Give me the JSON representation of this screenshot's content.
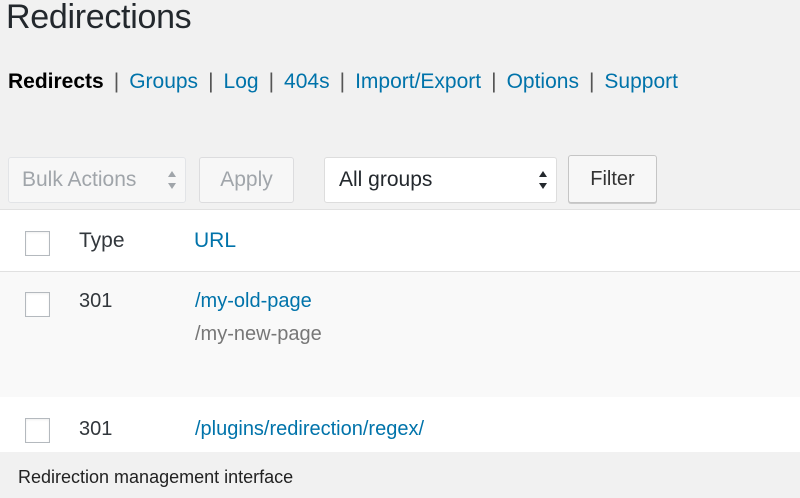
{
  "page": {
    "title": "Redirections"
  },
  "subnav": {
    "items": [
      {
        "label": "Redirects",
        "current": true
      },
      {
        "label": "Groups"
      },
      {
        "label": "Log"
      },
      {
        "label": "404s"
      },
      {
        "label": "Import/Export"
      },
      {
        "label": "Options"
      },
      {
        "label": "Support"
      }
    ],
    "separator": "|"
  },
  "toolbar": {
    "bulk_actions": "Bulk Actions",
    "apply_label": "Apply",
    "group_filter": "All groups",
    "filter_label": "Filter"
  },
  "table": {
    "columns": [
      "Type",
      "URL"
    ],
    "rows": [
      {
        "type": "301",
        "source": "/my-old-page",
        "target": "/my-new-page"
      },
      {
        "type": "301",
        "source": "/plugins/redirection/regex/",
        "target": ""
      }
    ]
  },
  "caption": "Redirection management interface",
  "colors": {
    "link": "#0073aa",
    "text": "#23282d",
    "muted": "#777777",
    "background": "#f1f1f1"
  },
  "icons": {
    "select_arrows": "up-down-arrows-icon"
  }
}
